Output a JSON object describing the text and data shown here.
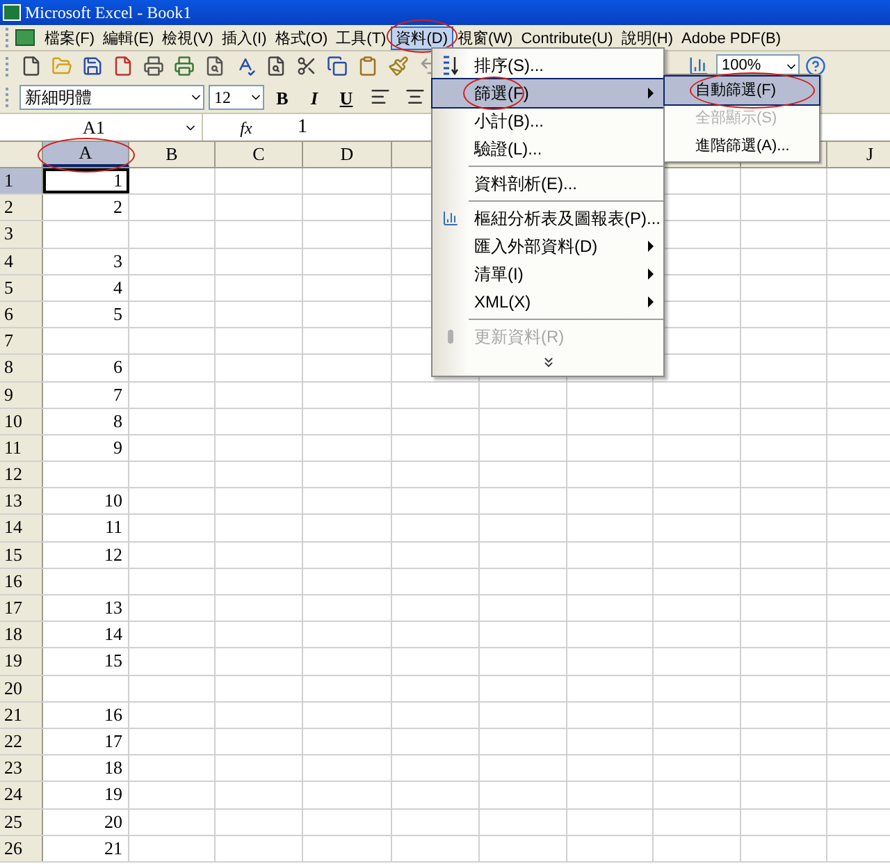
{
  "window": {
    "title": "Microsoft Excel - Book1"
  },
  "menubar": [
    {
      "label": "檔案(F)",
      "selected": false,
      "circled": false
    },
    {
      "label": "編輯(E)",
      "selected": false,
      "circled": false
    },
    {
      "label": "檢視(V)",
      "selected": false,
      "circled": false
    },
    {
      "label": "插入(I)",
      "selected": false,
      "circled": false
    },
    {
      "label": "格式(O)",
      "selected": false,
      "circled": false
    },
    {
      "label": "工具(T)",
      "selected": false,
      "circled": false
    },
    {
      "label": "資料(D)",
      "selected": true,
      "circled": true
    },
    {
      "label": "視窗(W)",
      "selected": false,
      "circled": false
    },
    {
      "label": "Contribute(U)",
      "selected": false,
      "circled": false
    },
    {
      "label": "說明(H)",
      "selected": false,
      "circled": false
    },
    {
      "label": "Adobe PDF(B)",
      "selected": false,
      "circled": false
    }
  ],
  "standard_toolbar": {
    "zoom": "100%"
  },
  "formatting_toolbar": {
    "font": "新細明體",
    "size": "12",
    "bold": "B",
    "italic": "I",
    "underline": "U"
  },
  "formula_bar": {
    "name_box": "A1",
    "fx": "fx",
    "value": "1"
  },
  "columns": [
    {
      "label": "A",
      "selected": true,
      "circled": true
    },
    {
      "label": "B",
      "selected": false,
      "circled": false
    },
    {
      "label": "C",
      "selected": false,
      "circled": false
    },
    {
      "label": "D",
      "selected": false,
      "circled": false
    },
    {
      "label": "J",
      "selected": false,
      "circled": false
    }
  ],
  "rows": [
    {
      "number": "1",
      "a": "1",
      "selected": true
    },
    {
      "number": "2",
      "a": "2",
      "selected": false
    },
    {
      "number": "3",
      "selected": false
    },
    {
      "number": "4",
      "a": "3",
      "selected": false
    },
    {
      "number": "5",
      "a": "4",
      "selected": false
    },
    {
      "number": "6",
      "a": "5",
      "selected": false
    },
    {
      "number": "7",
      "selected": false
    },
    {
      "number": "8",
      "a": "6",
      "selected": false
    },
    {
      "number": "9",
      "a": "7",
      "selected": false
    },
    {
      "number": "10",
      "a": "8",
      "selected": false
    },
    {
      "number": "11",
      "a": "9",
      "selected": false
    },
    {
      "number": "12",
      "selected": false
    },
    {
      "number": "13",
      "a": "10",
      "selected": false
    },
    {
      "number": "14",
      "a": "11",
      "selected": false
    },
    {
      "number": "15",
      "a": "12",
      "selected": false
    },
    {
      "number": "16",
      "selected": false
    },
    {
      "number": "17",
      "a": "13",
      "selected": false
    },
    {
      "number": "18",
      "a": "14",
      "selected": false
    },
    {
      "number": "19",
      "a": "15",
      "selected": false
    },
    {
      "number": "20",
      "selected": false
    },
    {
      "number": "21",
      "a": "16",
      "selected": false
    },
    {
      "number": "22",
      "a": "17",
      "selected": false
    },
    {
      "number": "23",
      "a": "18",
      "selected": false
    },
    {
      "number": "24",
      "a": "19",
      "selected": false
    },
    {
      "number": "25",
      "a": "20",
      "selected": false
    },
    {
      "number": "26",
      "a": "21",
      "selected": false
    }
  ],
  "data_menu": [
    {
      "kind": "item",
      "label": "排序(S)...",
      "selected": false,
      "circled": false,
      "disabled": false
    },
    {
      "kind": "submenu",
      "label": "篩選(F)",
      "selected": true,
      "circled": true,
      "disabled": false
    },
    {
      "kind": "item",
      "label": "小計(B)...",
      "selected": false,
      "circled": false,
      "disabled": false
    },
    {
      "kind": "item",
      "label": "驗證(L)...",
      "selected": false,
      "circled": false,
      "disabled": false
    },
    {
      "kind": "separator"
    },
    {
      "kind": "item",
      "label": "資料剖析(E)...",
      "selected": false,
      "circled": false,
      "disabled": false
    },
    {
      "kind": "separator"
    },
    {
      "kind": "item",
      "label": "樞紐分析表及圖報表(P)...",
      "selected": false,
      "circled": false,
      "disabled": false
    },
    {
      "kind": "submenu",
      "label": "匯入外部資料(D)",
      "selected": false,
      "circled": false,
      "disabled": false
    },
    {
      "kind": "submenu",
      "label": "清單(I)",
      "selected": false,
      "circled": false,
      "disabled": false
    },
    {
      "kind": "submenu",
      "label": "XML(X)",
      "selected": false,
      "circled": false,
      "disabled": false
    },
    {
      "kind": "separator"
    },
    {
      "kind": "item",
      "label": "更新資料(R)",
      "selected": false,
      "circled": false,
      "disabled": true
    },
    {
      "kind": "expand"
    }
  ],
  "filter_submenu": [
    {
      "label": "自動篩選(F)",
      "selected": true,
      "circled": true,
      "disabled": false
    },
    {
      "label": "全部顯示(S)",
      "selected": false,
      "circled": false,
      "disabled": true
    },
    {
      "label": "進階篩選(A)...",
      "selected": false,
      "circled": false,
      "disabled": false
    }
  ]
}
